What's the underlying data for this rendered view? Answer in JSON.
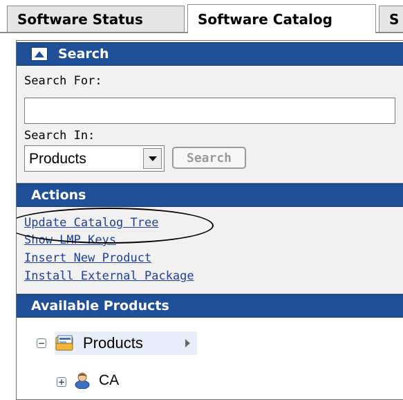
{
  "tabs": [
    {
      "label": "Software Status"
    },
    {
      "label": "Software Catalog"
    },
    {
      "label": "S"
    }
  ],
  "search": {
    "header": "Search",
    "search_for_label": "Search For:",
    "search_for_value": "",
    "search_in_label": "Search In:",
    "search_in_value": "Products",
    "button_label": "Search"
  },
  "actions": {
    "header": "Actions",
    "items": [
      {
        "label": "Update Catalog Tree"
      },
      {
        "label": "Show LMP Keys"
      },
      {
        "label": "Insert New Product"
      },
      {
        "label": "Install External Package"
      }
    ]
  },
  "available_products": {
    "header": "Available Products",
    "tree": {
      "root_label": "Products",
      "children": [
        {
          "label": "CA"
        }
      ]
    }
  },
  "colors": {
    "header_bg": "#1f4f96",
    "link": "#1f3f9a",
    "section_bg": "#f1f1f1"
  },
  "icons": [
    "collapse-up-icon",
    "dropdown-arrow-icon",
    "tree-collapse-icon",
    "tree-expand-icon",
    "catalog-folder-icon",
    "user-icon",
    "submenu-arrow-icon"
  ]
}
